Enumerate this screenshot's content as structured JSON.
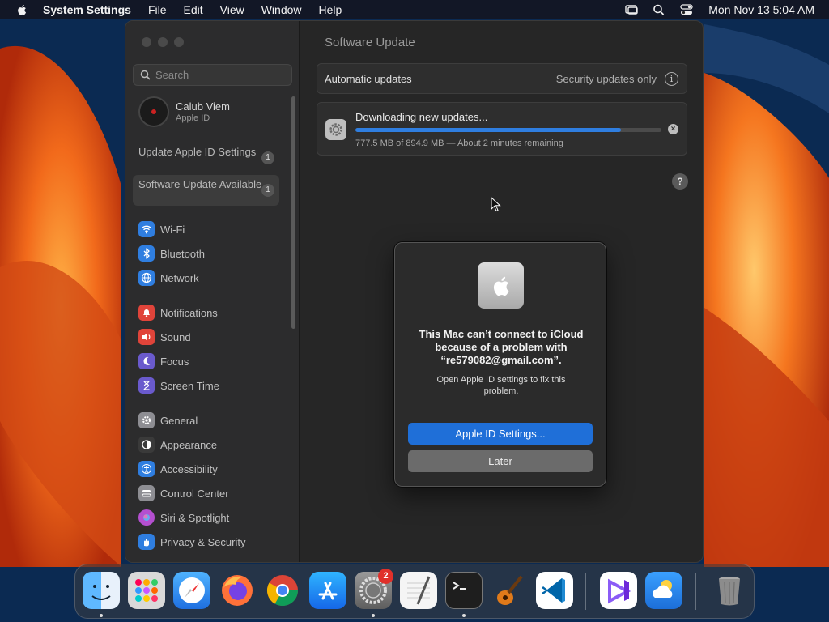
{
  "menubar": {
    "app_name": "System Settings",
    "menus": [
      "File",
      "Edit",
      "View",
      "Window",
      "Help"
    ],
    "clock": "Mon Nov 13  5:04 AM"
  },
  "sidebar": {
    "search_placeholder": "Search",
    "user": {
      "name": "Calub Viem",
      "subtitle": "Apple ID"
    },
    "notices": [
      {
        "label": "Update Apple ID Settings",
        "badge": "1"
      },
      {
        "label": "Software Update Available",
        "badge": "1"
      }
    ],
    "items": [
      {
        "label": "Wi-Fi",
        "color": "#2f7ee0",
        "icon": "wifi-icon"
      },
      {
        "label": "Bluetooth",
        "color": "#2f7ee0",
        "icon": "bluetooth-icon"
      },
      {
        "label": "Network",
        "color": "#2f7ee0",
        "icon": "globe-icon"
      },
      {
        "label": "Notifications",
        "color": "#e0443a",
        "icon": "bell-icon"
      },
      {
        "label": "Sound",
        "color": "#e0443a",
        "icon": "speaker-icon"
      },
      {
        "label": "Focus",
        "color": "#6a5acd",
        "icon": "moon-icon"
      },
      {
        "label": "Screen Time",
        "color": "#6a5acd",
        "icon": "hourglass-icon"
      },
      {
        "label": "General",
        "color": "#8e8e93",
        "icon": "gear-icon"
      },
      {
        "label": "Appearance",
        "color": "#3a3a3a",
        "icon": "appearance-icon"
      },
      {
        "label": "Accessibility",
        "color": "#2f7ee0",
        "icon": "accessibility-icon"
      },
      {
        "label": "Control Center",
        "color": "#8e8e93",
        "icon": "control-center-icon"
      },
      {
        "label": "Siri & Spotlight",
        "color": "#b44fd0",
        "icon": "siri-icon"
      },
      {
        "label": "Privacy & Security",
        "color": "#2f7ee0",
        "icon": "hand-icon"
      }
    ]
  },
  "main": {
    "title": "Software Update",
    "automatic_label": "Automatic updates",
    "automatic_value": "Security updates only",
    "download": {
      "title": "Downloading new updates...",
      "progress_fraction": 0.869,
      "progress_text": "777.5 MB of 894.9 MB — About 2 minutes remaining"
    }
  },
  "dialog": {
    "title": "This Mac can’t connect to iCloud because of a problem with “re579082@gmail.com”.",
    "message": "Open Apple ID settings to fix this problem.",
    "primary_button": "Apple ID Settings...",
    "secondary_button": "Later"
  },
  "dock": {
    "apps": [
      "finder",
      "launchpad",
      "safari",
      "firefox",
      "chrome",
      "app-store",
      "system-settings",
      "textedit",
      "terminal",
      "garageband",
      "vscode",
      "visual-studio",
      "weather",
      "trash"
    ],
    "system_settings_badge": "2"
  }
}
